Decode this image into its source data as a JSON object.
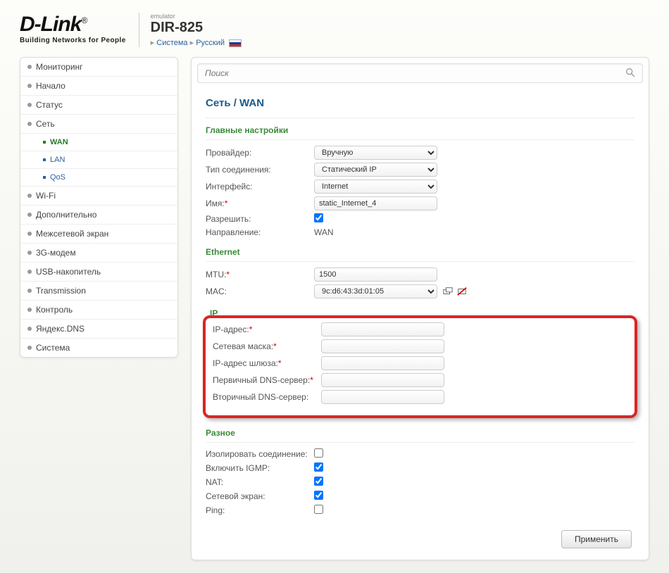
{
  "header": {
    "logo_main": "D-Link",
    "logo_sub": "Building Networks for People",
    "emulator": "emulator",
    "model": "DIR-825",
    "bc_system": "Система",
    "bc_lang": "Русский"
  },
  "search": {
    "placeholder": "Поиск"
  },
  "sidebar": {
    "items": [
      {
        "label": "Мониторинг"
      },
      {
        "label": "Начало"
      },
      {
        "label": "Статус"
      },
      {
        "label": "Сеть"
      },
      {
        "label": "Wi-Fi"
      },
      {
        "label": "Дополнительно"
      },
      {
        "label": "Межсетевой экран"
      },
      {
        "label": "3G-модем"
      },
      {
        "label": "USB-накопитель"
      },
      {
        "label": "Transmission"
      },
      {
        "label": "Контроль"
      },
      {
        "label": "Яндекс.DNS"
      },
      {
        "label": "Система"
      }
    ],
    "sub": {
      "wan": "WAN",
      "lan": "LAN",
      "qos": "QoS"
    }
  },
  "breadcrumb": "Сеть / WAN",
  "sections": {
    "main": "Главные настройки",
    "ethernet": "Ethernet",
    "ip": "IP",
    "misc": "Разное"
  },
  "fields": {
    "provider": {
      "label": "Провайдер:",
      "value": "Вручную"
    },
    "conn_type": {
      "label": "Тип соединения:",
      "value": "Статический IP"
    },
    "iface": {
      "label": "Интерфейс:",
      "value": "Internet"
    },
    "name": {
      "label": "Имя:",
      "value": "static_Internet_4"
    },
    "allow": {
      "label": "Разрешить:"
    },
    "direction": {
      "label": "Направление:",
      "value": "WAN"
    },
    "mtu": {
      "label": "MTU:",
      "value": "1500"
    },
    "mac": {
      "label": "MAC:",
      "value": "9c:d6:43:3d:01:05"
    },
    "ip_addr": {
      "label": "IP-адрес:",
      "value": ""
    },
    "netmask": {
      "label": "Сетевая маска:",
      "value": ""
    },
    "gateway": {
      "label": "IP-адрес шлюза:",
      "value": ""
    },
    "dns1": {
      "label": "Первичный DNS-сервер:",
      "value": ""
    },
    "dns2": {
      "label": "Вторичный DNS-сервер:",
      "value": ""
    },
    "isolate": {
      "label": "Изолировать соединение:"
    },
    "igmp": {
      "label": "Включить IGMP:"
    },
    "nat": {
      "label": "NAT:"
    },
    "fw": {
      "label": "Сетевой экран:"
    },
    "ping": {
      "label": "Ping:"
    }
  },
  "actions": {
    "apply": "Применить"
  }
}
